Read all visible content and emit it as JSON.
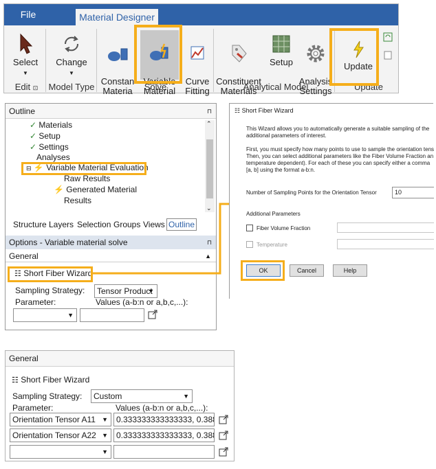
{
  "ribbon": {
    "tabs": [
      "File",
      "Material Designer"
    ],
    "buttons": {
      "select": "Select",
      "change": "Change",
      "constant": "Constan\nMateria",
      "variable": "Variable\nMaterial",
      "curve": "Curve\nFitting",
      "constituent": "Constituent\nMaterials",
      "setup": "Setup",
      "analysis": "Analysis\nSettings",
      "update": "Update"
    },
    "groups": {
      "edit": "Edit",
      "model_type": "Model Type",
      "solve": "Solve",
      "analytical": "Analytical Model",
      "update": "Update"
    }
  },
  "outline": {
    "title": "Outline",
    "tree": [
      "Materials",
      "Setup",
      "Settings",
      "Analyses",
      "Variable Material Evaluation",
      "Raw Results",
      "Generated Material",
      "Results"
    ],
    "bottom_tabs": [
      "Structure",
      "Layers",
      "Selection",
      "Groups",
      "Views",
      "Outline"
    ],
    "options_title": "Options - Variable material solve",
    "general": "General",
    "wizard_link": "Short Fiber Wizard",
    "sampling_label": "Sampling Strategy:",
    "sampling_value": "Tensor Product",
    "parameter_label": "Parameter:",
    "values_label": "Values (a-b:n or a,b,c,...):"
  },
  "wizard": {
    "title": "Short Fiber Wizard",
    "lines": [
      "This Wizard allows you to automatically generate a suitable sampling of the",
      "additional parameters of interest.",
      "First, you must specify how many points to use to sample the orientation tens",
      "Then, you can select additional parameters like the Fiber Volume Fraction an",
      "temperature dependent). For each of these you can specify either a comma",
      "[a, b] using the format a-b:n."
    ],
    "points_label": "Number of Sampling Points for the Orientation Tensor",
    "points_value": "10",
    "additional": "Additional Parameters",
    "fiber": "Fiber Volume Fraction",
    "temperature": "Temperature",
    "ok": "OK",
    "cancel": "Cancel",
    "help": "Help"
  },
  "general2": {
    "title": "General",
    "wizard_link": "Short Fiber Wizard",
    "sampling_label": "Sampling Strategy:",
    "sampling_value": "Custom",
    "parameter_label": "Parameter:",
    "values_label": "Values (a-b:n or a,b,c,...):",
    "rows": [
      {
        "param": "Orientation Tensor A11",
        "values": "0.333333333333333, 0.3888"
      },
      {
        "param": "Orientation Tensor A22",
        "values": "0.333333333333333, 0.3888"
      },
      {
        "param": "",
        "values": ""
      }
    ]
  },
  "colors": {
    "accent": "#f5ae1b",
    "tab": "#2f62a8"
  }
}
